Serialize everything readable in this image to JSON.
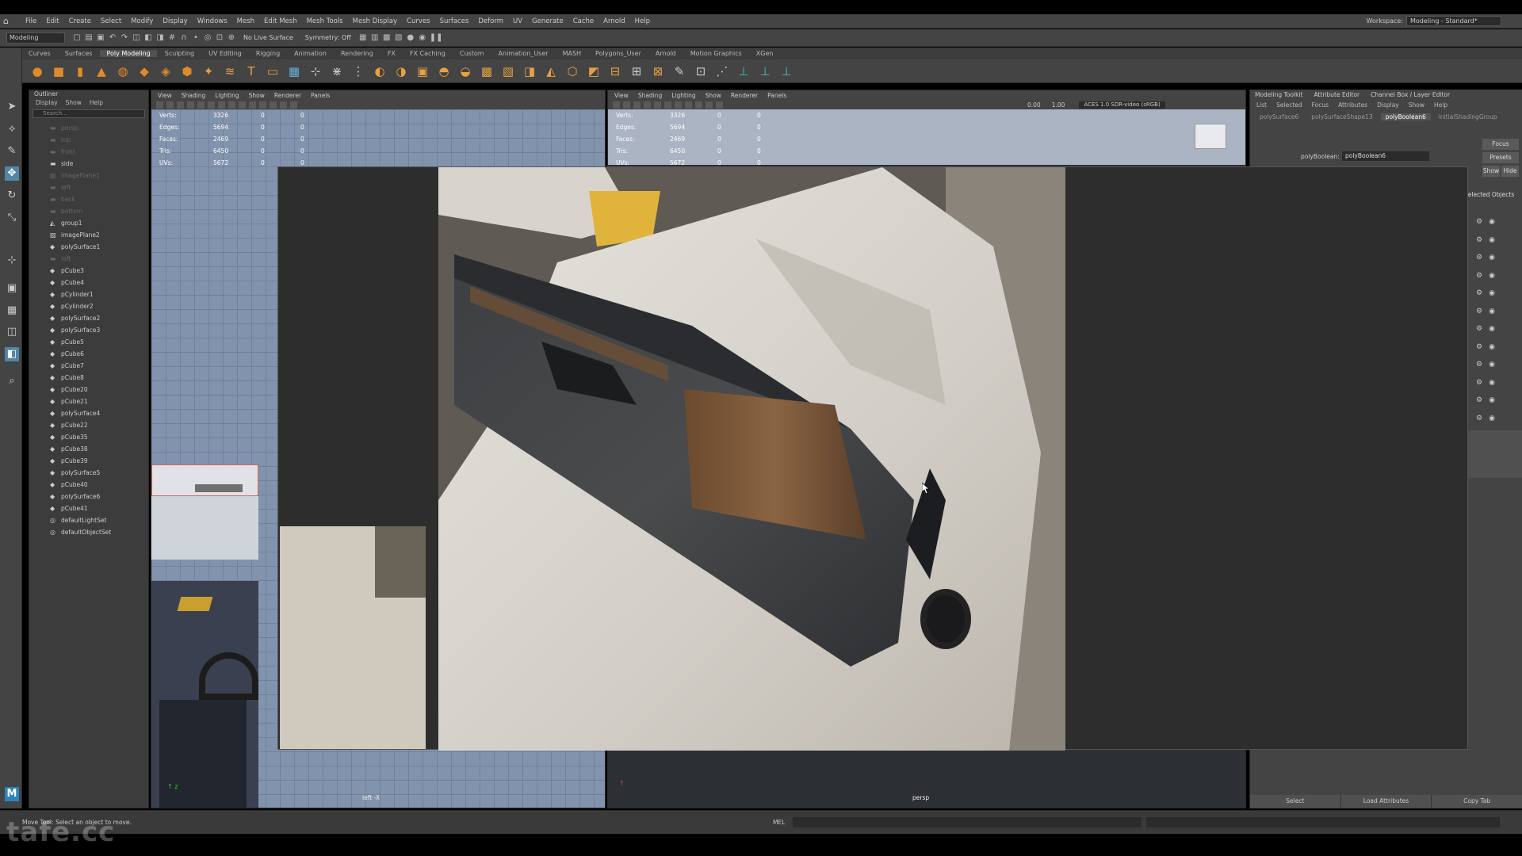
{
  "menubar": {
    "items": [
      "File",
      "Edit",
      "Create",
      "Select",
      "Modify",
      "Display",
      "Windows",
      "Mesh",
      "Edit Mesh",
      "Mesh Tools",
      "Mesh Display",
      "Curves",
      "Surfaces",
      "Deform",
      "UV",
      "Generate",
      "Cache",
      "Arnold",
      "Help"
    ],
    "workspace_label": "Workspace:",
    "workspace_value": "Modeling - Standard*"
  },
  "statusline": {
    "mode": "Modeling",
    "live_surface": "No Live Surface",
    "symmetry": "Symmetry: Off"
  },
  "shelf": {
    "tabs": [
      "Curves",
      "Surfaces",
      "Poly Modeling",
      "Sculpting",
      "UV Editing",
      "Rigging",
      "Animation",
      "Rendering",
      "FX",
      "FX Caching",
      "Custom",
      "Animation_User",
      "MASH",
      "Polygons_User",
      "Arnold",
      "Motion Graphics",
      "XGen"
    ],
    "active_tab": "Poly Modeling"
  },
  "outliner": {
    "title": "Outliner",
    "menu": [
      "Display",
      "Show",
      "Help"
    ],
    "search_placeholder": "Search...",
    "items": [
      {
        "name": "persp",
        "dim": true,
        "icon": "camera-icon"
      },
      {
        "name": "top",
        "dim": true,
        "icon": "camera-icon"
      },
      {
        "name": "front",
        "dim": true,
        "icon": "camera-icon"
      },
      {
        "name": "side",
        "dim": false,
        "icon": "camera-icon"
      },
      {
        "name": "imagePlane1",
        "dim": true,
        "icon": "image-plane-icon"
      },
      {
        "name": "left",
        "dim": true,
        "icon": "camera-icon"
      },
      {
        "name": "back",
        "dim": true,
        "icon": "camera-icon"
      },
      {
        "name": "bottom",
        "dim": true,
        "icon": "camera-icon"
      },
      {
        "name": "group1",
        "dim": false,
        "icon": "group-icon"
      },
      {
        "name": "imagePlane2",
        "dim": false,
        "icon": "image-plane-icon"
      },
      {
        "name": "polySurface1",
        "dim": false,
        "icon": "mesh-icon"
      },
      {
        "name": "left",
        "dim": true,
        "icon": "camera-icon"
      },
      {
        "name": "pCube3",
        "dim": false,
        "icon": "mesh-icon"
      },
      {
        "name": "pCube4",
        "dim": false,
        "icon": "mesh-icon"
      },
      {
        "name": "pCylinder1",
        "dim": false,
        "icon": "mesh-icon"
      },
      {
        "name": "pCylinder2",
        "dim": false,
        "icon": "mesh-icon"
      },
      {
        "name": "polySurface2",
        "dim": false,
        "icon": "mesh-icon"
      },
      {
        "name": "polySurface3",
        "dim": false,
        "icon": "mesh-icon"
      },
      {
        "name": "pCube5",
        "dim": false,
        "icon": "mesh-icon"
      },
      {
        "name": "pCube6",
        "dim": false,
        "icon": "mesh-icon"
      },
      {
        "name": "pCube7",
        "dim": false,
        "icon": "mesh-icon"
      },
      {
        "name": "pCube8",
        "dim": false,
        "icon": "mesh-icon"
      },
      {
        "name": "pCube20",
        "dim": false,
        "icon": "mesh-icon"
      },
      {
        "name": "pCube21",
        "dim": false,
        "icon": "mesh-icon"
      },
      {
        "name": "polySurface4",
        "dim": false,
        "icon": "mesh-icon"
      },
      {
        "name": "pCube22",
        "dim": false,
        "icon": "mesh-icon"
      },
      {
        "name": "pCube35",
        "dim": false,
        "icon": "mesh-icon"
      },
      {
        "name": "pCube38",
        "dim": false,
        "icon": "mesh-icon"
      },
      {
        "name": "pCube39",
        "dim": false,
        "icon": "mesh-icon"
      },
      {
        "name": "polySurface5",
        "dim": false,
        "icon": "mesh-icon"
      },
      {
        "name": "pCube40",
        "dim": false,
        "icon": "mesh-icon"
      },
      {
        "name": "polySurface6",
        "dim": false,
        "icon": "mesh-icon"
      },
      {
        "name": "pCube41",
        "dim": false,
        "icon": "mesh-icon"
      },
      {
        "name": "defaultLightSet",
        "dim": false,
        "icon": "set-icon"
      },
      {
        "name": "defaultObjectSet",
        "dim": false,
        "icon": "set-icon"
      }
    ]
  },
  "viewport_left": {
    "menu": [
      "View",
      "Shading",
      "Lighting",
      "Show",
      "Renderer",
      "Panels"
    ],
    "hud": [
      {
        "label": "Verts:",
        "v1": "3326",
        "v2": "0",
        "v3": "0"
      },
      {
        "label": "Edges:",
        "v1": "5694",
        "v2": "0",
        "v3": "0"
      },
      {
        "label": "Faces:",
        "v1": "2469",
        "v2": "0",
        "v3": "0"
      },
      {
        "label": "Tris:",
        "v1": "6450",
        "v2": "0",
        "v3": "0"
      },
      {
        "label": "UVs:",
        "v1": "5672",
        "v2": "0",
        "v3": "0"
      }
    ],
    "camera_label": "left -X"
  },
  "viewport_right": {
    "menu": [
      "View",
      "Shading",
      "Lighting",
      "Show",
      "Renderer",
      "Panels"
    ],
    "hud": [
      {
        "label": "Verts:",
        "v1": "3326",
        "v2": "0",
        "v3": "0"
      },
      {
        "label": "Edges:",
        "v1": "5694",
        "v2": "0",
        "v3": "0"
      },
      {
        "label": "Faces:",
        "v1": "2469",
        "v2": "0",
        "v3": "0"
      },
      {
        "label": "Tris:",
        "v1": "6450",
        "v2": "0",
        "v3": "0"
      },
      {
        "label": "UVs:",
        "v1": "5672",
        "v2": "0",
        "v3": "0"
      }
    ],
    "exposure": "0.00",
    "gamma": "1.00",
    "colorspace": "ACES 1.0 SDR-video (sRGB)",
    "camera_label": "persp"
  },
  "attribute_editor": {
    "tabs": [
      "Modeling Toolkit",
      "Attribute Editor",
      "Channel Box / Layer Editor"
    ],
    "menu": [
      "List",
      "Selected",
      "Focus",
      "Attributes",
      "Display",
      "Show",
      "Help"
    ],
    "node_tabs": [
      "polySurface6",
      "polySurfaceShape13",
      "polyBoolean6",
      "initialShadingGroup"
    ],
    "active_node_tab": "polyBoolean6",
    "field_label": "polyBoolean:",
    "field_value": "polyBoolean6",
    "focus_btn": "Focus",
    "presets_btn": "Presets",
    "show_btn": "Show",
    "hide_btn": "Hide",
    "selected_objects": "Selected Objects",
    "bottom_buttons": [
      "Select",
      "Load Attributes",
      "Copy Tab"
    ]
  },
  "commandline": {
    "help_text": "Move Tool: Select an object to move.",
    "mel_label": "MEL"
  },
  "watermark": "tafe.cc",
  "colors": {
    "ui_bg": "#444444",
    "viewport_grid": "#8294ad",
    "accent_blue": "#5285a6"
  }
}
